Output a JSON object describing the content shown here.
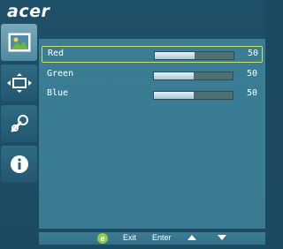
{
  "logo": "acer",
  "colors": {
    "background": "#1d4a63",
    "panel": "#3a7d95",
    "active_tab": "#7aa8ba",
    "selection_border": "#c8e26a",
    "slider_fill": "#e7f1f6",
    "enter_icon": "#8fce3e"
  },
  "sidebar": {
    "tabs": [
      {
        "icon": "picture-icon",
        "active": true
      },
      {
        "icon": "position-icon",
        "active": false
      },
      {
        "icon": "settings-wrench-icon",
        "active": false
      },
      {
        "icon": "info-icon",
        "active": false
      }
    ]
  },
  "settings": [
    {
      "label": "Red",
      "value": "50",
      "level": 50,
      "selected": true
    },
    {
      "label": "Green",
      "value": "50",
      "level": 50,
      "selected": false
    },
    {
      "label": "Blue",
      "value": "50",
      "level": 50,
      "selected": false
    }
  ],
  "footer": {
    "enter_icon": "e",
    "exit_label": "Exit",
    "enter_label": "Enter",
    "up_icon": "up-arrow-icon",
    "down_icon": "down-arrow-icon"
  }
}
